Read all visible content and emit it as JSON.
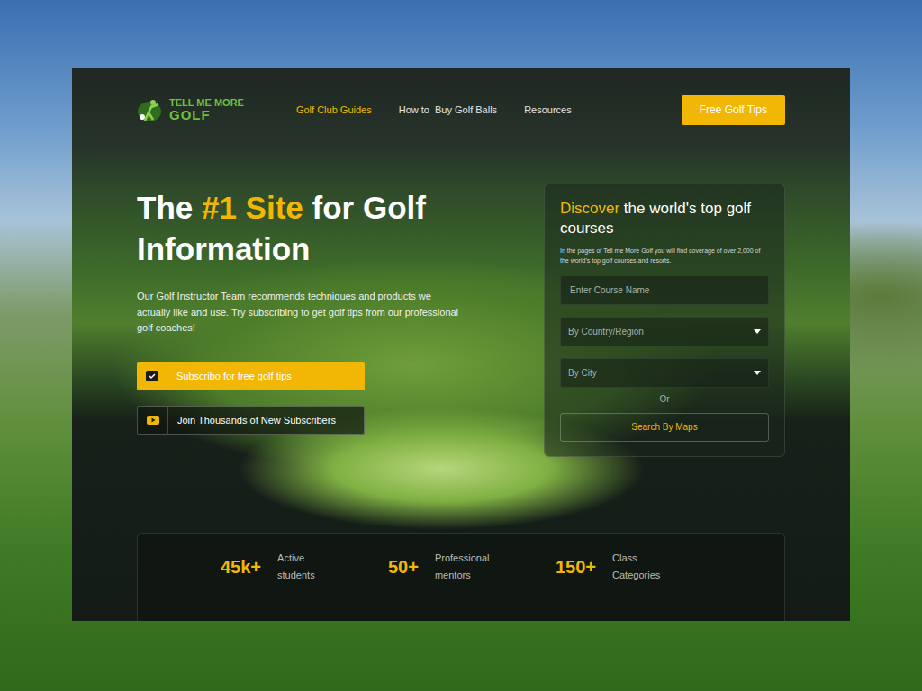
{
  "logo": {
    "line1": "TELL ME MORE",
    "line2": "GOLF"
  },
  "nav": [
    {
      "label": "Golf Club Guides",
      "selected": true
    },
    {
      "label": "How to  Buy Golf Balls",
      "selected": false
    },
    {
      "label": "Resources",
      "selected": false
    }
  ],
  "cta": "Free Golf Tips",
  "hero": {
    "title_before": "The ",
    "title_highlight": "#1 Site",
    "title_after": " for Golf Information",
    "body": "Our Golf Instructor Team recommends techniques and products we actually like and use. Try subscribing to get golf tips from our professional golf coaches!",
    "buttons": [
      {
        "label": "Subscribo for free golf tips",
        "kind": "primary"
      },
      {
        "label": "Join Thousands of New Subscribers",
        "kind": "outline"
      }
    ]
  },
  "search": {
    "title_highlight": "Discover",
    "title_rest": " the world's top golf courses",
    "description": "In the pages of  Tell me More Golf you will find coverage of over 2,000 of the world's top golf courses and resorts.",
    "fields": [
      {
        "placeholder": "Enter Course Name",
        "kind": "text"
      },
      {
        "placeholder": "By Country/Region",
        "kind": "select"
      },
      {
        "placeholder": "By City",
        "kind": "select"
      }
    ],
    "separator": "Or",
    "map_button": "Search By Maps"
  },
  "stats": [
    {
      "value": "45k+",
      "label": "Active students"
    },
    {
      "value": "50+",
      "label": "Professional mentors"
    },
    {
      "value": "150+",
      "label": "Class Categories"
    }
  ]
}
